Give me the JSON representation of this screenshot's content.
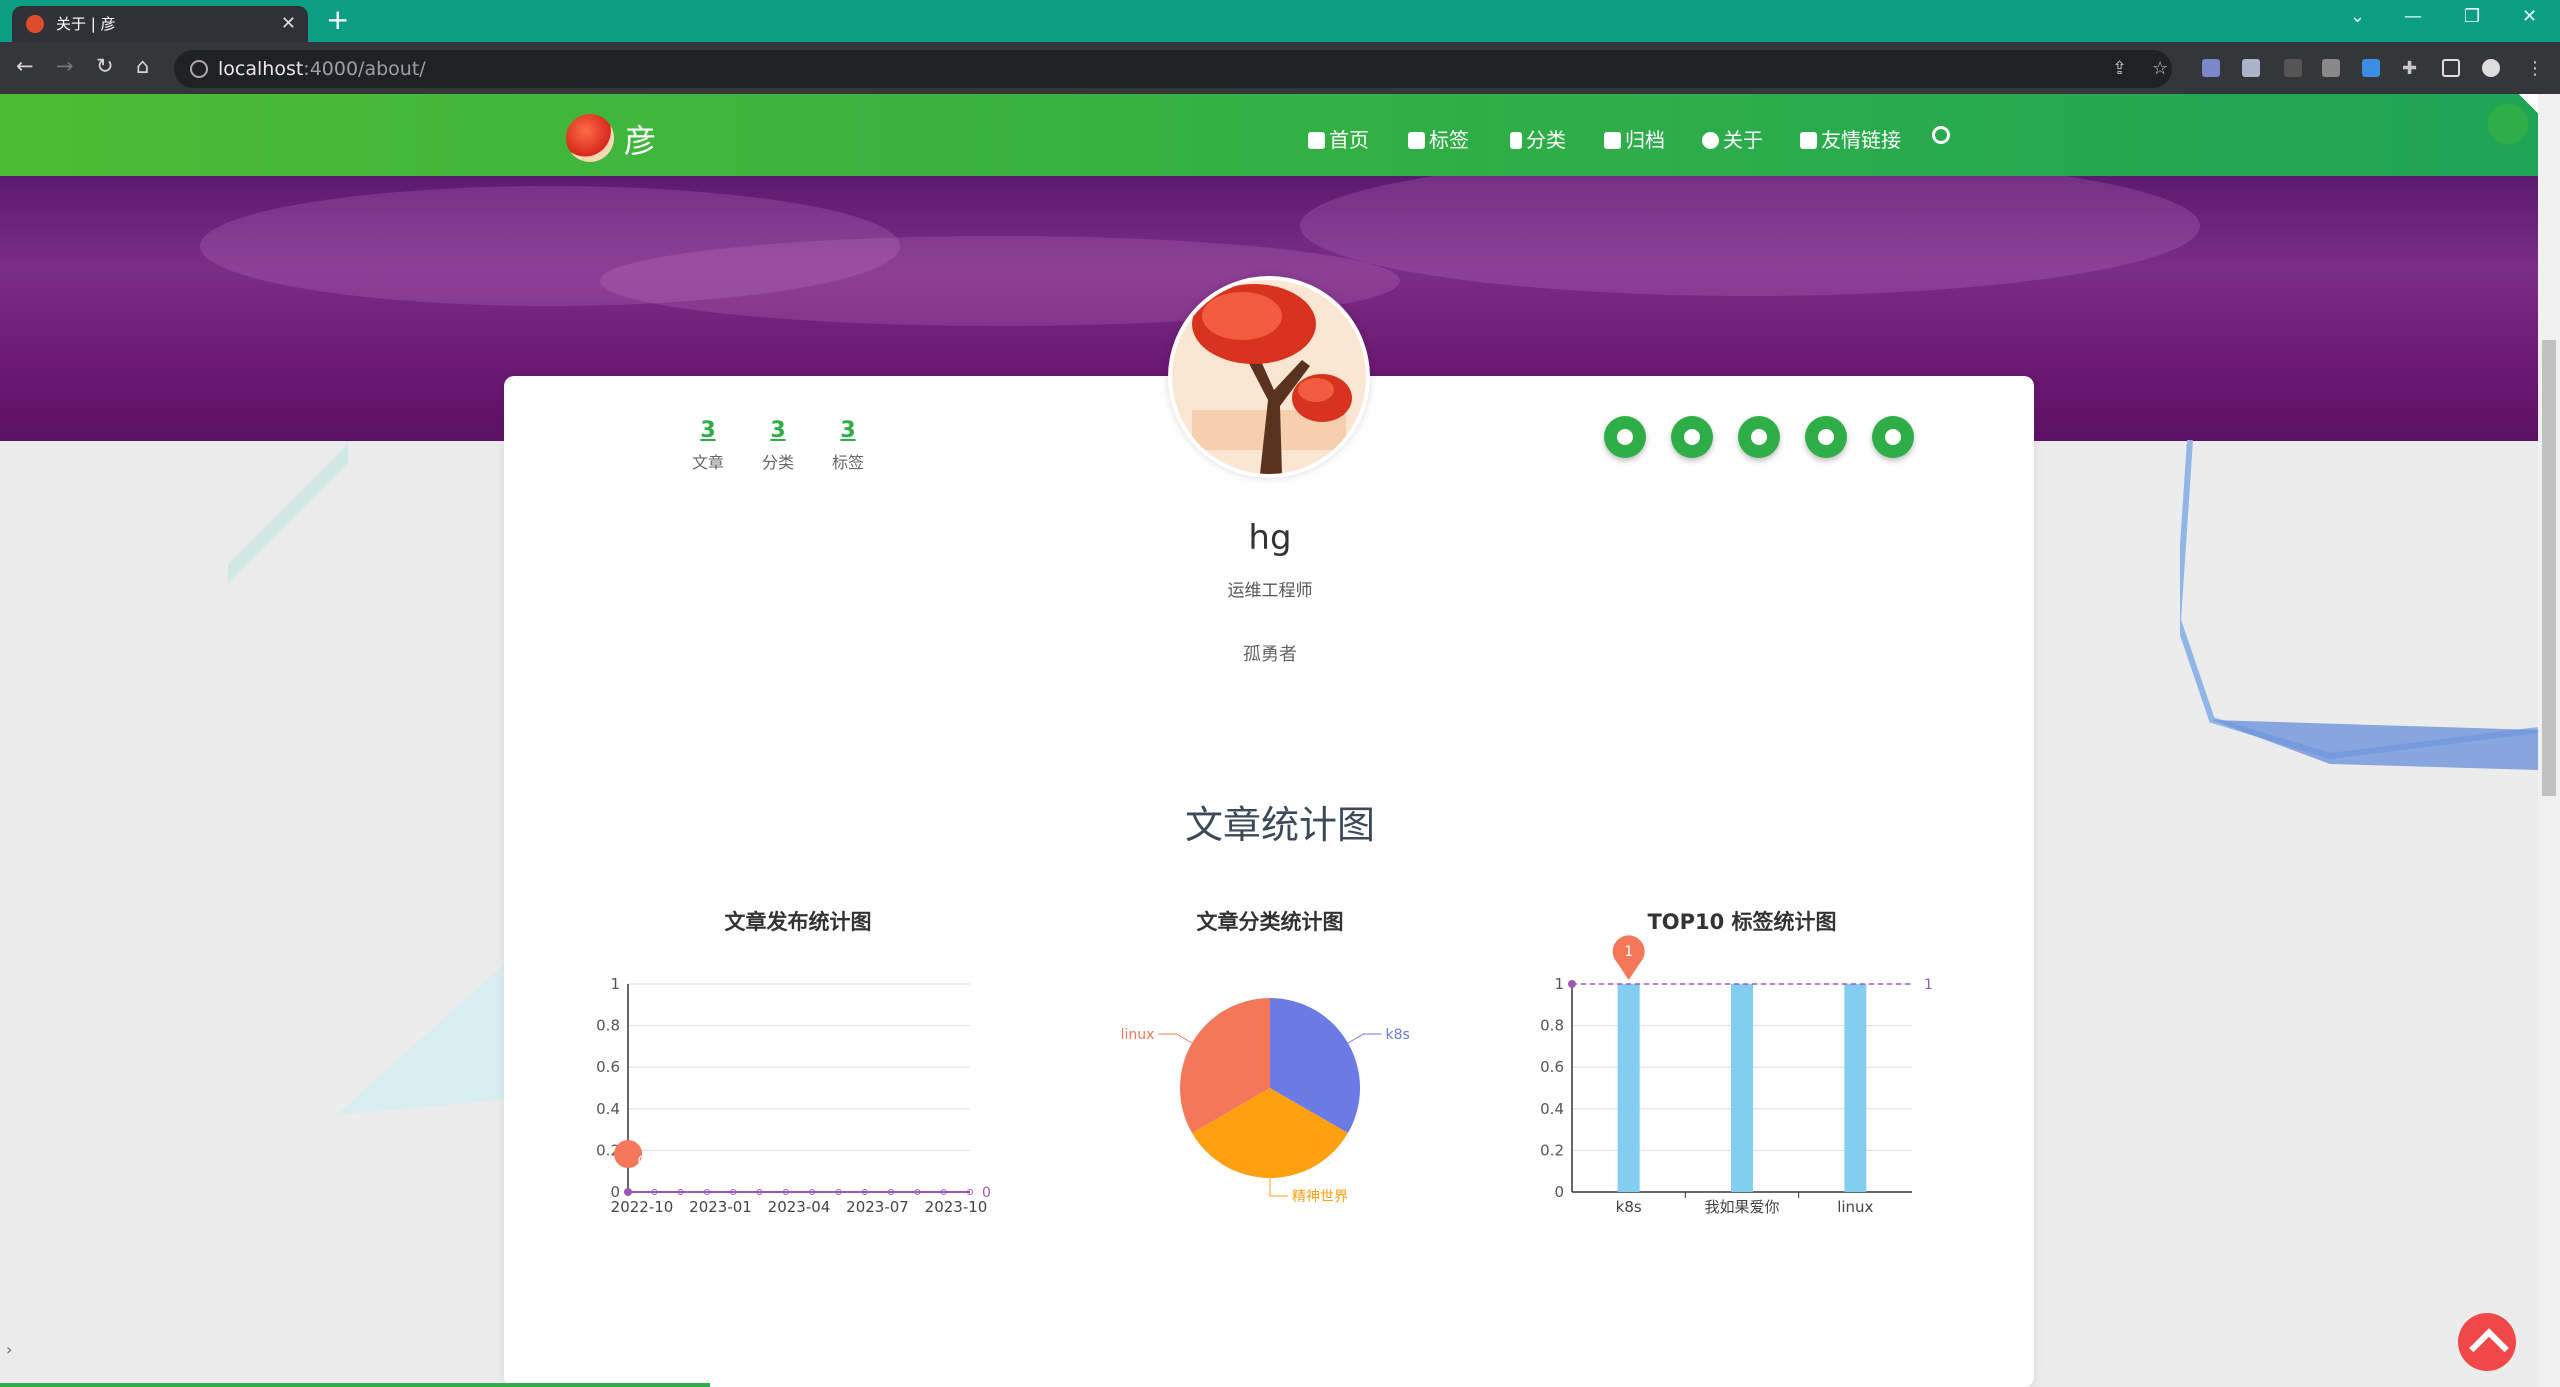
{
  "browser": {
    "tab_title": "关于 | 彦",
    "url_host": "localhost",
    "url_rest": ":4000/about/"
  },
  "site": {
    "logo_text": "彦",
    "menu": [
      "首页",
      "标签",
      "分类",
      "归档",
      "关于",
      "友情链接"
    ]
  },
  "profile": {
    "stats": [
      {
        "num": "3",
        "label": "文章"
      },
      {
        "num": "3",
        "label": "分类"
      },
      {
        "num": "3",
        "label": "标签"
      }
    ],
    "name": "hg",
    "title": "运维工程师",
    "motto": "孤勇者",
    "social_icons": [
      "github-icon",
      "twitter-icon",
      "qq-icon",
      "weibo-icon",
      "rss-icon"
    ]
  },
  "section_title": "文章统计图",
  "colors": {
    "accent": "#2fae47",
    "banner": "#6c1a73",
    "pie": [
      "#6b7ae4",
      "#ffa013",
      "#f5775a"
    ],
    "bar": "#83cdf0"
  },
  "chart_data": [
    {
      "type": "line",
      "title": "文章发布统计图",
      "x": [
        "2022-10",
        "2023-01",
        "2023-04",
        "2023-07",
        "2023-10"
      ],
      "y_ticks": [
        "0",
        "0.2",
        "0.4",
        "0.6",
        "0.8",
        "1"
      ],
      "ylim": [
        0,
        1
      ],
      "values": [
        0,
        0,
        0,
        0,
        0,
        0,
        0,
        0,
        0,
        0,
        0,
        0,
        0,
        0
      ],
      "markpoint": "0",
      "markline": "0"
    },
    {
      "type": "pie",
      "title": "文章分类统计图",
      "categories": [
        "k8s",
        "精神世界",
        "linux"
      ],
      "values": [
        1,
        1,
        1
      ]
    },
    {
      "type": "bar",
      "title": "TOP10 标签统计图",
      "categories": [
        "k8s",
        "我如果爱你",
        "linux"
      ],
      "values": [
        1,
        1,
        1
      ],
      "y_ticks": [
        "0",
        "0.2",
        "0.4",
        "0.6",
        "0.8",
        "1"
      ],
      "ylim": [
        0,
        1
      ],
      "markpoint": "1",
      "markline": "1"
    }
  ]
}
